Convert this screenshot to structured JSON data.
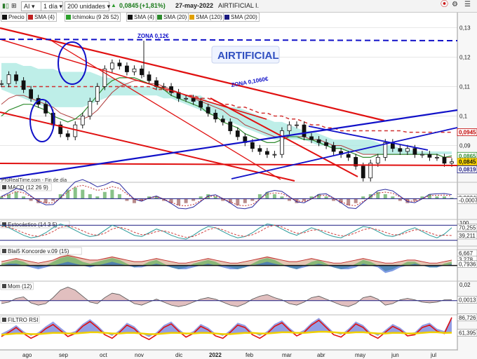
{
  "toolbar": {
    "symbol": "AI",
    "interval": "1 día",
    "units": "200 unidades",
    "price": "0,0845",
    "change": "(+1,81%)",
    "date": "27-may-2022",
    "name": "AIRTIFICIAL I."
  },
  "indicators": [
    {
      "label": "Precio",
      "color": "#111111"
    },
    {
      "label": "SMA (4)",
      "color": "#c02020"
    },
    {
      "label": "Ichimoku (9 26 52)",
      "color": "#2ca02c"
    },
    {
      "label": "SMA (4)",
      "color": "#111111"
    },
    {
      "label": "SMA (20)",
      "color": "#2e8b2e"
    },
    {
      "label": "SMA (120)",
      "color": "#e0a000"
    },
    {
      "label": "SMA (200)",
      "color": "#1a1a80"
    }
  ],
  "annotations": {
    "zona_top": "ZONA 0,12€",
    "zona_mid": "ZONA 0,1060€",
    "ticker_box": "AIRTIFICIAL",
    "watermark": "ProRealTime.com - Fin de día"
  },
  "colors": {
    "red": "#e01010",
    "blue": "#1010c8",
    "ichimoku_cloud": "#a8e8e0",
    "price_tag": "#c00000"
  },
  "chart_data": {
    "type": "line",
    "main": {
      "ylim": [
        0.078,
        0.132
      ],
      "yticks": [
        {
          "v": 0.13,
          "label": "0,13"
        },
        {
          "v": 0.12,
          "label": "0,12"
        },
        {
          "v": 0.11,
          "label": "0,11"
        },
        {
          "v": 0.1,
          "label": "0,1"
        },
        {
          "v": 0.09,
          "label": "0,09"
        }
      ],
      "price_tags": [
        {
          "v": 0.0945,
          "label": "0,0945",
          "bg": "#ffffff",
          "fg": "#c00000",
          "border": "#c00000"
        },
        {
          "v": 0.0865,
          "label": "0,0865",
          "bg": "#ffffff",
          "fg": "#2e8b2e",
          "border": "#2e8b2e"
        },
        {
          "v": 0.0845,
          "label": "0,0845",
          "bg": "#ffd800",
          "fg": "#111111",
          "border": "#b89000"
        },
        {
          "v": 0.0819,
          "label": "0,0819",
          "bg": "#ffffff",
          "fg": "#1a1a80",
          "border": "#1a1a80"
        }
      ],
      "close": [
        0.111,
        0.114,
        0.112,
        0.109,
        0.106,
        0.104,
        0.101,
        0.097,
        0.094,
        0.093,
        0.097,
        0.1,
        0.105,
        0.11,
        0.116,
        0.118,
        0.117,
        0.115,
        0.116,
        0.114,
        0.112,
        0.11,
        0.11,
        0.108,
        0.106,
        0.106,
        0.105,
        0.103,
        0.101,
        0.099,
        0.098,
        0.095,
        0.093,
        0.091,
        0.089,
        0.088,
        0.087,
        0.087,
        0.095,
        0.097,
        0.097,
        0.093,
        0.092,
        0.091,
        0.09,
        0.088,
        0.087,
        0.086,
        0.083,
        0.079,
        0.084,
        0.086,
        0.091,
        0.089,
        0.088,
        0.089,
        0.087,
        0.087,
        0.086,
        0.086,
        0.084,
        0.0845
      ],
      "sma_red": [
        0.104,
        0.106,
        0.107,
        0.107,
        0.106,
        0.105,
        0.104,
        0.103,
        0.101,
        0.1,
        0.099,
        0.099,
        0.1,
        0.102,
        0.105,
        0.108,
        0.11,
        0.111,
        0.112,
        0.112,
        0.111,
        0.111,
        0.11,
        0.109,
        0.108,
        0.107,
        0.106,
        0.105,
        0.104,
        0.103,
        0.102,
        0.1,
        0.099,
        0.097,
        0.096,
        0.095,
        0.094,
        0.093,
        0.093,
        0.093,
        0.093,
        0.093,
        0.092,
        0.092,
        0.091,
        0.09,
        0.09,
        0.089,
        0.088,
        0.087,
        0.087,
        0.087,
        0.087,
        0.087,
        0.087,
        0.087,
        0.087,
        0.087,
        0.087,
        0.087,
        0.086,
        0.086
      ],
      "sma_green": [
        0.1,
        0.102,
        0.103,
        0.104,
        0.104,
        0.103,
        0.102,
        0.1,
        0.099,
        0.098,
        0.099,
        0.101,
        0.104,
        0.107,
        0.11,
        0.112,
        0.113,
        0.113,
        0.113,
        0.112,
        0.111,
        0.11,
        0.109,
        0.107,
        0.106,
        0.105,
        0.104,
        0.103,
        0.101,
        0.1,
        0.098,
        0.097,
        0.096,
        0.094,
        0.093,
        0.092,
        0.091,
        0.091,
        0.092,
        0.093,
        0.093,
        0.092,
        0.092,
        0.091,
        0.09,
        0.089,
        0.089,
        0.088,
        0.087,
        0.086,
        0.086,
        0.087,
        0.087,
        0.087,
        0.087,
        0.087,
        0.087,
        0.087,
        0.087,
        0.087,
        0.086,
        0.0865
      ],
      "cloud_top": [
        0.118,
        0.118,
        0.118,
        0.117,
        0.117,
        0.116,
        0.116,
        0.116,
        0.115,
        0.115,
        0.115,
        0.115,
        0.115,
        0.114,
        0.113,
        0.113,
        0.112,
        0.111,
        0.11,
        0.11,
        0.11,
        0.11,
        0.109,
        0.108,
        0.108,
        0.107,
        0.107,
        0.107,
        0.105,
        0.104,
        0.104,
        0.103,
        0.103,
        0.102,
        0.101,
        0.1,
        0.099,
        0.098,
        0.098,
        0.097,
        0.096,
        0.095,
        0.095,
        0.094,
        0.093,
        0.092,
        0.092,
        0.092,
        0.092,
        0.092,
        0.092,
        0.091,
        0.09,
        0.09,
        0.089,
        0.089,
        0.088,
        0.088,
        0.088,
        0.088,
        0.088,
        0.088
      ],
      "cloud_bot": [
        0.109,
        0.108,
        0.107,
        0.106,
        0.105,
        0.104,
        0.103,
        0.103,
        0.103,
        0.103,
        0.103,
        0.103,
        0.104,
        0.105,
        0.106,
        0.107,
        0.107,
        0.107,
        0.107,
        0.107,
        0.107,
        0.107,
        0.106,
        0.106,
        0.105,
        0.104,
        0.103,
        0.102,
        0.101,
        0.1,
        0.099,
        0.098,
        0.097,
        0.096,
        0.095,
        0.094,
        0.093,
        0.092,
        0.092,
        0.092,
        0.092,
        0.092,
        0.091,
        0.09,
        0.09,
        0.089,
        0.089,
        0.088,
        0.088,
        0.087,
        0.087,
        0.087,
        0.087,
        0.087,
        0.087,
        0.087,
        0.087,
        0.087,
        0.087,
        0.087,
        0.087,
        0.087
      ],
      "sma_dashed": [
        0.11,
        0.11,
        0.11,
        0.11,
        0.11,
        0.11,
        0.11,
        0.11,
        0.11,
        0.11,
        0.11,
        0.11,
        0.11,
        0.11,
        0.11,
        0.11,
        0.11,
        0.11,
        0.11,
        0.11,
        0.11,
        0.109,
        0.109,
        0.108,
        0.108,
        0.107,
        0.107,
        0.106,
        0.106,
        0.105,
        0.104,
        0.104,
        0.103,
        0.103,
        0.102,
        0.101,
        0.101,
        0.1,
        0.1,
        0.099,
        0.099,
        0.098,
        0.097,
        0.097,
        0.096,
        0.096,
        0.095,
        0.095,
        0.095,
        0.095,
        0.095,
        0.095,
        0.095,
        0.095,
        0.095,
        0.0945,
        0.0945,
        0.0945,
        0.0945,
        0.0945,
        0.0945,
        0.0945
      ]
    },
    "x_labels": [
      "ago",
      "sep",
      "oct",
      "nov",
      "dic",
      "2022",
      "feb",
      "mar",
      "abr",
      "may",
      "jun",
      "jul"
    ],
    "panels": [
      {
        "name": "MACD (12 26 9)",
        "ylim": [
          -0.009,
          0.007
        ],
        "tags": [
          {
            "v": 0.0004,
            "label": "0,0004"
          },
          {
            "v": -0.0007,
            "label": "-0,0007"
          }
        ],
        "hist": [
          0.001,
          0.002,
          0.003,
          0.001,
          -0.001,
          -0.002,
          -0.002,
          -0.001,
          0.002,
          0.004,
          0.005,
          0.004,
          0.002,
          0.001,
          0.003,
          0.004,
          0.002,
          -0.001,
          -0.002,
          -0.001,
          0.001,
          0.001,
          -0.001,
          -0.002,
          -0.003,
          -0.002,
          -0.001,
          0.001,
          0.002,
          0.001,
          -0.001,
          -0.002,
          -0.003,
          -0.002,
          -0.001,
          0.002,
          0.003,
          0.002,
          0.001,
          -0.001,
          -0.002,
          -0.001,
          0.001,
          0.002,
          0.001,
          -0.001,
          -0.002,
          -0.003,
          -0.002,
          0.001,
          0.002,
          0.003,
          0.002,
          0.001,
          -0.001,
          -0.002,
          -0.001,
          0.001,
          0.002,
          0.001,
          0.001,
          0.0004
        ]
      },
      {
        "name": "Estocástico (14 3 5)",
        "ylim": [
          0,
          100
        ],
        "topLabel": "100",
        "tags": [
          {
            "v": 70.255,
            "label": "70,255"
          },
          {
            "v": 39.211,
            "label": "39,211"
          }
        ],
        "k": [
          80,
          70,
          55,
          40,
          30,
          35,
          50,
          70,
          85,
          75,
          60,
          45,
          35,
          40,
          60,
          80,
          70,
          55,
          40,
          35,
          50,
          65,
          55,
          40,
          30,
          25,
          40,
          60,
          75,
          70,
          55,
          40,
          30,
          35,
          50,
          70,
          85,
          80,
          65,
          50,
          40,
          55,
          70,
          60,
          45,
          35,
          30,
          45,
          60,
          75,
          70,
          55,
          40,
          35,
          45,
          60,
          70,
          55,
          40,
          30,
          45,
          70.255
        ],
        "d": [
          75,
          72,
          62,
          50,
          40,
          36,
          42,
          55,
          72,
          78,
          70,
          58,
          45,
          40,
          48,
          65,
          72,
          65,
          52,
          42,
          45,
          55,
          58,
          50,
          40,
          32,
          35,
          48,
          62,
          70,
          62,
          50,
          40,
          36,
          42,
          55,
          72,
          80,
          73,
          60,
          48,
          50,
          60,
          62,
          55,
          45,
          38,
          40,
          50,
          62,
          68,
          62,
          52,
          42,
          42,
          52,
          62,
          60,
          50,
          40,
          40,
          39.211
        ]
      },
      {
        "name": "Blai5 Koncorde v.09 (15)",
        "ylim": [
          -8,
          10
        ],
        "tags": [
          {
            "v": 6.6,
            "label": "6,667"
          },
          {
            "v": 3.2,
            "label": "3,278"
          },
          {
            "v": 0.7936,
            "label": "0,7936"
          }
        ],
        "brown": [
          2,
          3,
          4,
          3,
          2,
          1,
          2,
          3,
          5,
          6,
          5,
          4,
          3,
          3,
          4,
          5,
          4,
          3,
          2,
          2,
          3,
          4,
          3,
          2,
          1,
          1,
          2,
          3,
          4,
          3,
          2,
          1,
          1,
          2,
          3,
          4,
          5,
          4,
          3,
          2,
          2,
          3,
          4,
          3,
          2,
          1,
          1,
          2,
          3,
          4,
          3,
          2,
          1,
          1,
          2,
          3,
          3,
          2,
          1,
          1,
          2,
          3
        ],
        "green": [
          1,
          2,
          3,
          2,
          0,
          -1,
          0,
          2,
          4,
          5,
          4,
          2,
          1,
          2,
          3,
          4,
          3,
          1,
          -1,
          0,
          2,
          3,
          1,
          -1,
          -2,
          -1,
          1,
          2,
          3,
          2,
          0,
          -1,
          -2,
          -1,
          1,
          3,
          4,
          3,
          1,
          -1,
          -2,
          0,
          2,
          3,
          1,
          -1,
          -2,
          -1,
          1,
          3,
          2,
          0,
          -3,
          -2,
          0,
          2,
          2,
          0,
          -1,
          -1,
          1,
          2
        ],
        "blue": [
          0,
          1,
          1,
          0,
          -1,
          -2,
          -1,
          0,
          1,
          2,
          1,
          0,
          -1,
          0,
          1,
          2,
          1,
          0,
          -1,
          -1,
          0,
          1,
          0,
          -1,
          -2,
          -2,
          -1,
          0,
          1,
          0,
          -1,
          -2,
          -2,
          -1,
          0,
          1,
          2,
          1,
          0,
          -1,
          -2,
          -1,
          0,
          1,
          0,
          -1,
          -2,
          -2,
          -1,
          1,
          0,
          -1,
          -4,
          -3,
          -1,
          0,
          1,
          0,
          -1,
          -1,
          0,
          0.8
        ]
      },
      {
        "name": "Mom (12)",
        "ylim": [
          -0.018,
          0.025
        ],
        "topLabel": "0,02",
        "tags": [
          {
            "v": 0.0013,
            "label": "0,0013"
          }
        ],
        "values": [
          -0.004,
          -0.002,
          0.003,
          0.005,
          -0.003,
          -0.006,
          -0.004,
          0.004,
          0.014,
          0.018,
          0.014,
          0.006,
          -0.002,
          -0.004,
          0.004,
          0.01,
          0.008,
          0.002,
          -0.004,
          -0.006,
          -0.002,
          0.002,
          -0.002,
          -0.006,
          -0.008,
          -0.006,
          -0.002,
          0.002,
          0.004,
          0.002,
          -0.002,
          -0.006,
          -0.008,
          -0.004,
          0.002,
          0.006,
          0.008,
          0.004,
          0.001,
          -0.004,
          -0.006,
          -0.002,
          0.004,
          0.006,
          0.002,
          -0.002,
          -0.006,
          -0.008,
          -0.004,
          0.004,
          0.006,
          0.002,
          -0.006,
          -0.004,
          0.001,
          0.003,
          0.001,
          -0.002,
          -0.003,
          -0.002,
          0.001,
          0.0013
        ]
      },
      {
        "name": "FILTRO RSI",
        "ylim": [
          35,
          90
        ],
        "tags": [
          {
            "v": 86.726,
            "label": "86,726"
          },
          {
            "v": 61.395,
            "label": "61,395"
          }
        ],
        "red": [
          55,
          62,
          70,
          60,
          52,
          58,
          68,
          75,
          65,
          55,
          60,
          72,
          80,
          70,
          58,
          52,
          62,
          74,
          68,
          56,
          50,
          58,
          70,
          76,
          64,
          54,
          60,
          72,
          66,
          56,
          52,
          62,
          74,
          70,
          58,
          52,
          60,
          72,
          78,
          66,
          56,
          62,
          74,
          82,
          70,
          58,
          54,
          64,
          76,
          70,
          58,
          52,
          62,
          72,
          66,
          56,
          58,
          70,
          74,
          64,
          60,
          86.726
        ],
        "blue": [
          60,
          66,
          74,
          64,
          56,
          62,
          72,
          80,
          70,
          60,
          64,
          76,
          84,
          74,
          62,
          56,
          66,
          78,
          72,
          60,
          54,
          62,
          74,
          80,
          68,
          58,
          64,
          76,
          70,
          60,
          56,
          66,
          78,
          74,
          62,
          56,
          64,
          76,
          82,
          70,
          60,
          66,
          78,
          86,
          74,
          62,
          58,
          68,
          80,
          74,
          62,
          56,
          66,
          76,
          70,
          60,
          62,
          74,
          78,
          68,
          64,
          88
        ],
        "yellow": [
          58,
          59,
          60,
          60,
          59,
          59,
          60,
          61,
          61,
          60,
          60,
          61,
          62,
          62,
          61,
          60,
          60,
          61,
          61,
          60,
          59,
          59,
          60,
          61,
          61,
          60,
          60,
          61,
          61,
          60,
          59,
          59,
          60,
          61,
          61,
          60,
          60,
          61,
          62,
          62,
          61,
          61,
          62,
          63,
          63,
          62,
          61,
          61,
          62,
          62,
          61,
          60,
          60,
          61,
          61,
          60,
          60,
          61,
          62,
          62,
          61,
          61.395
        ]
      }
    ]
  }
}
